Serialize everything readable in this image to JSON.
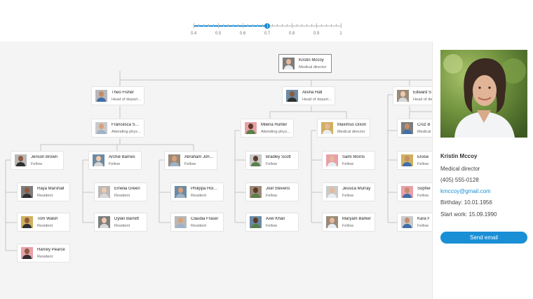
{
  "zoom": {
    "value": 0.7,
    "min": 0.4,
    "max": 1.0,
    "labels": [
      "0.4",
      "0.5",
      "0.6",
      "0.7",
      "0.8",
      "0.9",
      "1"
    ]
  },
  "nodes": [
    {
      "id": "kristin",
      "name": "Kristin Mccoy",
      "title": "Medical director"
    },
    {
      "id": "theo",
      "name": "Theo Fisher",
      "title": "Head of departm..."
    },
    {
      "id": "alisha",
      "name": "Alisha Hall",
      "title": "Head of departm..."
    },
    {
      "id": "edward",
      "name": "Edward S",
      "title": "Head of de"
    },
    {
      "id": "francesca",
      "name": "Francesca Saued...",
      "title": "Attending physici..."
    },
    {
      "id": "milena",
      "name": "Milena Hunter",
      "title": "Attending physici..."
    },
    {
      "id": "maximus",
      "name": "Maximus Dixon",
      "title": "Medical director"
    },
    {
      "id": "cruz",
      "name": "Cruz B",
      "title": "Medical d"
    },
    {
      "id": "jenson",
      "name": "Jenson Brown",
      "title": "Fellow"
    },
    {
      "id": "archie",
      "name": "Archie Barnes",
      "title": "Fellow"
    },
    {
      "id": "abraham",
      "name": "Abraham Johnst...",
      "title": "Fellow"
    },
    {
      "id": "bradley",
      "name": "Bradley Scott",
      "title": "Fellow"
    },
    {
      "id": "sami",
      "name": "Sami Morris",
      "title": "Fellow"
    },
    {
      "id": "eloise",
      "name": "Eloise",
      "title": "Fellow"
    },
    {
      "id": "raya",
      "name": "Raya Marshall",
      "title": "Resident"
    },
    {
      "id": "emelia",
      "name": "Emelia Green",
      "title": "Resident"
    },
    {
      "id": "philippa",
      "name": "Philippa Holmes",
      "title": "Resident"
    },
    {
      "id": "joel",
      "name": "Joel Stevens",
      "title": "Fellow"
    },
    {
      "id": "jessica",
      "name": "Jessica Murray",
      "title": "Fellow"
    },
    {
      "id": "sophie",
      "name": "Sophie",
      "title": "Fellow"
    },
    {
      "id": "tom",
      "name": "Tom Walsh",
      "title": "Resident"
    },
    {
      "id": "dylan",
      "name": "Dylan Barrett",
      "title": "Resident"
    },
    {
      "id": "claudia",
      "name": "Claudia Fraser",
      "title": "Resident"
    },
    {
      "id": "axel",
      "name": "Axel Khan",
      "title": "Fellow"
    },
    {
      "id": "maryam",
      "name": "Maryam Barker",
      "title": "Fellow"
    },
    {
      "id": "kara",
      "name": "Kara F",
      "title": "Fellow"
    },
    {
      "id": "harvey",
      "name": "Harvey Pearce",
      "title": "Resident"
    }
  ],
  "details": {
    "name": "Kristin Mccoy",
    "title": "Medical director",
    "phone": "(405) 555-0128",
    "email": "kmccoy@gmail.com",
    "birthday": "Birthday: 10.01.1956",
    "start_work": "Start work: 15.09.1990",
    "send_label": "Send email"
  },
  "colors": {
    "accent": "#1a8fd6",
    "canvas": "#f4f4f4",
    "connector": "#c4c4c4"
  }
}
